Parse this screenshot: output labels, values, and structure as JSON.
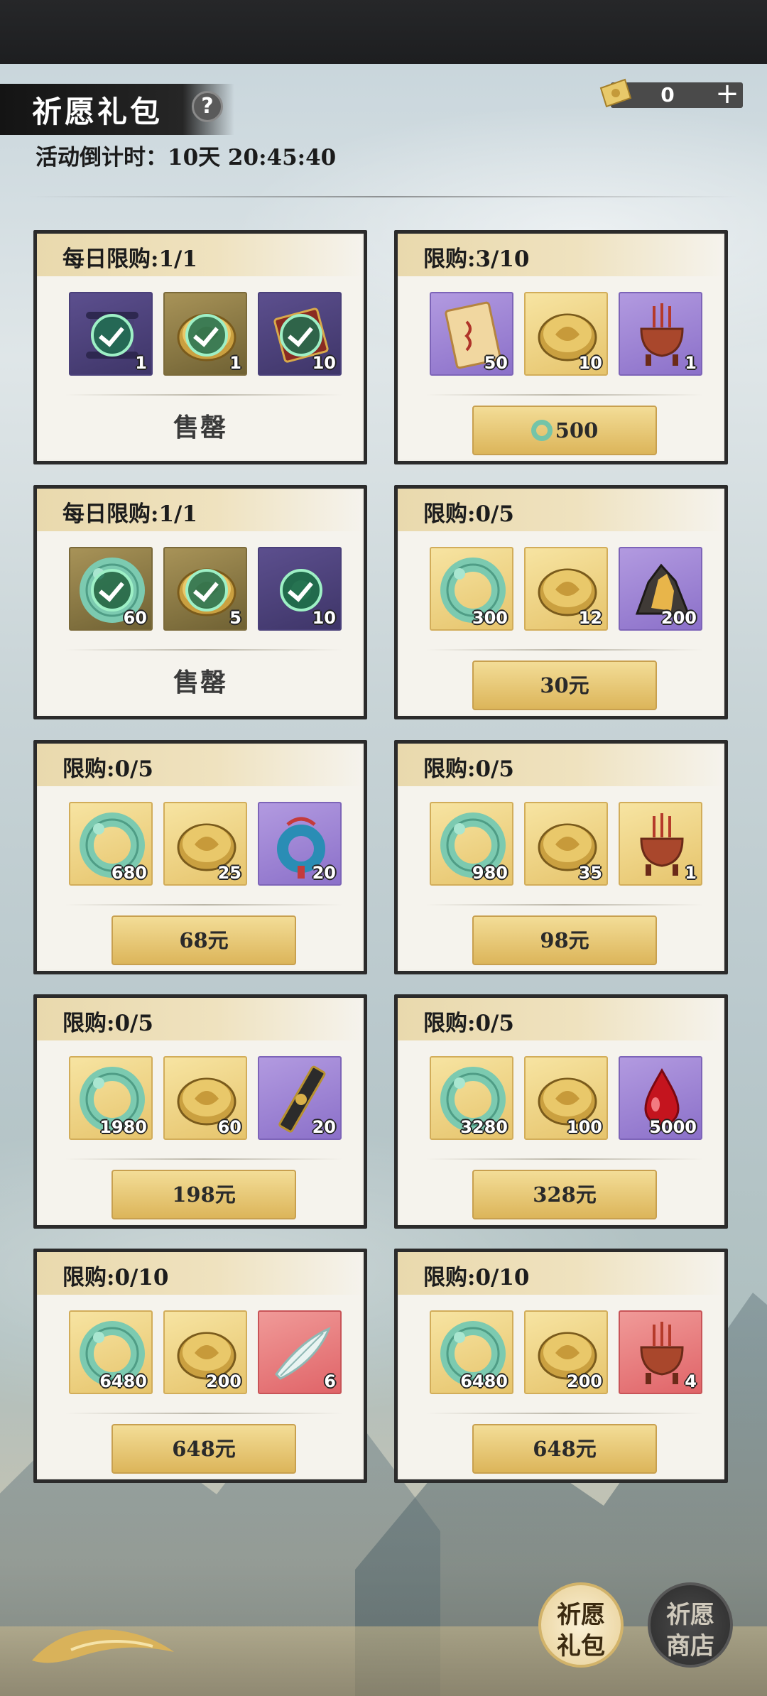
{
  "header": {
    "title": "祈愿礼包",
    "help_symbol": "?",
    "countdown": "活动倒计时：10天 20:45:40",
    "currency_value": "0",
    "currency_plus": "+"
  },
  "packs": [
    {
      "limit": "每日限购:1/1",
      "sold_out": true,
      "action": "售罄",
      "items": [
        {
          "qty": "1",
          "bg": "dpurple",
          "icon": "scroll-icon"
        },
        {
          "qty": "1",
          "bg": "dgold",
          "icon": "gold-coin-icon"
        },
        {
          "qty": "10",
          "bg": "dpurple",
          "icon": "ticket-icon"
        }
      ]
    },
    {
      "limit": "限购:3/10",
      "sold_out": false,
      "action": "500",
      "action_icon": "jade-currency-icon",
      "items": [
        {
          "qty": "50",
          "bg": "purple",
          "icon": "talisman-paper-icon"
        },
        {
          "qty": "10",
          "bg": "gold",
          "icon": "gold-coin-icon"
        },
        {
          "qty": "1",
          "bg": "purple",
          "icon": "incense-burner-icon"
        }
      ]
    },
    {
      "limit": "每日限购:1/1",
      "sold_out": true,
      "action": "售罄",
      "items": [
        {
          "qty": "60",
          "bg": "dgold",
          "icon": "jade-ring-icon"
        },
        {
          "qty": "5",
          "bg": "dgold",
          "icon": "gold-coin-icon"
        },
        {
          "qty": "10",
          "bg": "dpurple",
          "icon": "flower-icon"
        }
      ]
    },
    {
      "limit": "限购:0/5",
      "sold_out": false,
      "action": "30元",
      "items": [
        {
          "qty": "300",
          "bg": "gold",
          "icon": "jade-ring-icon"
        },
        {
          "qty": "12",
          "bg": "gold",
          "icon": "gold-coin-icon"
        },
        {
          "qty": "200",
          "bg": "purple",
          "icon": "ore-icon"
        }
      ]
    },
    {
      "limit": "限购:0/5",
      "sold_out": false,
      "action": "68元",
      "items": [
        {
          "qty": "680",
          "bg": "gold",
          "icon": "jade-ring-icon"
        },
        {
          "qty": "25",
          "bg": "gold",
          "icon": "gold-coin-icon"
        },
        {
          "qty": "20",
          "bg": "purple",
          "icon": "jade-pendant-icon"
        }
      ]
    },
    {
      "limit": "限购:0/5",
      "sold_out": false,
      "action": "98元",
      "items": [
        {
          "qty": "980",
          "bg": "gold",
          "icon": "jade-ring-icon"
        },
        {
          "qty": "35",
          "bg": "gold",
          "icon": "gold-coin-icon"
        },
        {
          "qty": "1",
          "bg": "gold",
          "icon": "incense-burner-icon"
        }
      ]
    },
    {
      "limit": "限购:0/5",
      "sold_out": false,
      "action": "198元",
      "items": [
        {
          "qty": "1980",
          "bg": "gold",
          "icon": "jade-ring-icon"
        },
        {
          "qty": "60",
          "bg": "gold",
          "icon": "gold-coin-icon"
        },
        {
          "qty": "20",
          "bg": "purple",
          "icon": "ink-stick-icon"
        }
      ]
    },
    {
      "limit": "限购:0/5",
      "sold_out": false,
      "action": "328元",
      "items": [
        {
          "qty": "3280",
          "bg": "gold",
          "icon": "jade-ring-icon"
        },
        {
          "qty": "100",
          "bg": "gold",
          "icon": "gold-coin-icon"
        },
        {
          "qty": "5000",
          "bg": "purple",
          "icon": "blood-drop-icon"
        }
      ]
    },
    {
      "limit": "限购:0/10",
      "sold_out": false,
      "action": "648元",
      "items": [
        {
          "qty": "6480",
          "bg": "gold",
          "icon": "jade-ring-icon"
        },
        {
          "qty": "200",
          "bg": "gold",
          "icon": "gold-coin-icon"
        },
        {
          "qty": "6",
          "bg": "red",
          "icon": "feather-icon"
        }
      ]
    },
    {
      "limit": "限购:0/10",
      "sold_out": false,
      "action": "648元",
      "items": [
        {
          "qty": "6480",
          "bg": "gold",
          "icon": "jade-ring-icon"
        },
        {
          "qty": "200",
          "bg": "gold",
          "icon": "gold-coin-icon"
        },
        {
          "qty": "4",
          "bg": "red",
          "icon": "incense-burner-icon"
        }
      ]
    }
  ],
  "nav": {
    "pack_line1": "祈愿",
    "pack_line2": "礼包",
    "shop_line1": "祈愿",
    "shop_line2": "商店"
  }
}
